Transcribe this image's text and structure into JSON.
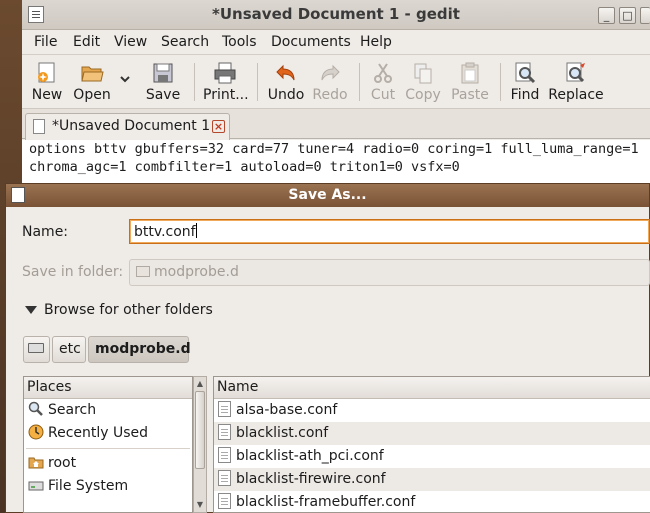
{
  "gedit": {
    "title": "*Unsaved Document 1 - gedit",
    "window_buttons": {
      "minimize": "_",
      "maximize": "□",
      "close": "×"
    },
    "menu": [
      "File",
      "Edit",
      "View",
      "Search",
      "Tools",
      "Documents",
      "Help"
    ],
    "toolbar": {
      "new": "New",
      "open": "Open",
      "save": "Save",
      "print": "Print...",
      "undo": "Undo",
      "redo": "Redo",
      "cut": "Cut",
      "copy": "Copy",
      "paste": "Paste",
      "find": "Find",
      "replace": "Replace"
    },
    "tab": {
      "label": "*Unsaved Document 1",
      "close": "×"
    },
    "editor_lines": [
      "options bttv gbuffers=32 card=77 tuner=4 radio=0 coring=1 full_luma_range=1",
      "chroma_agc=1 combfilter=1 autoload=0 triton1=0 vsfx=0"
    ]
  },
  "save_dialog": {
    "title": "Save As...",
    "name_label": "Name:",
    "name_value": "bttv.conf",
    "folder_label": "Save in folder:",
    "folder_value": "modprobe.d",
    "browse_label": "Browse for other folders",
    "breadcrumb": [
      "etc",
      "modprobe.d"
    ],
    "places_header": "Places",
    "places": [
      {
        "label": "Search",
        "icon": "search-icon"
      },
      {
        "label": "Recently Used",
        "icon": "clock-icon"
      },
      {
        "label": "root",
        "icon": "home-folder-icon"
      },
      {
        "label": "File System",
        "icon": "drive-icon"
      }
    ],
    "files_header": "Name",
    "files": [
      "alsa-base.conf",
      "blacklist.conf",
      "blacklist-ath_pci.conf",
      "blacklist-firewire.conf",
      "blacklist-framebuffer.conf"
    ]
  }
}
